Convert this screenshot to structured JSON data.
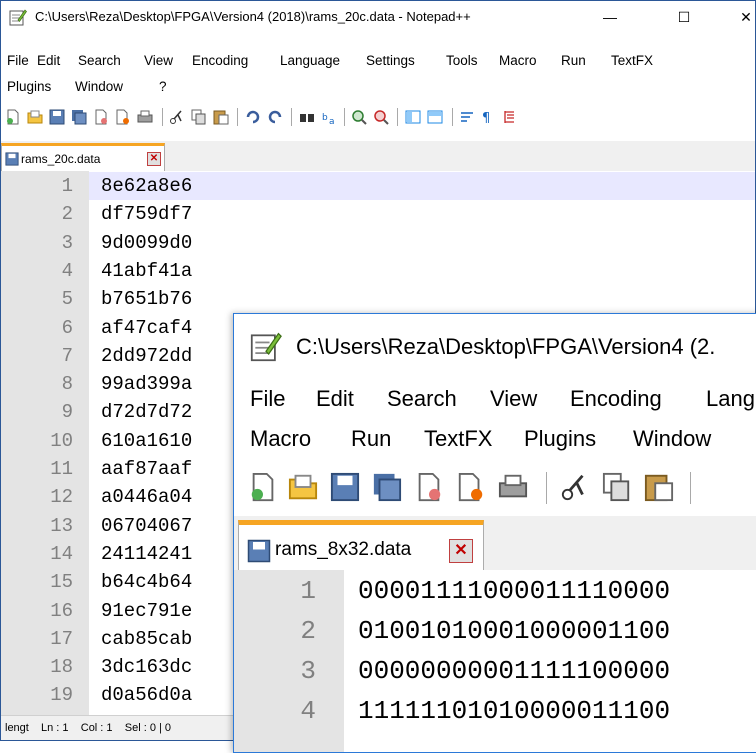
{
  "window1": {
    "title": "C:\\Users\\Reza\\Desktop\\FPGA\\Version4 (2018)\\rams_20c.data - Notepad++",
    "controls": {
      "minimize": "—",
      "maximize": "☐",
      "close": "✕"
    },
    "menu_row1": [
      "File",
      "Edit",
      "Search",
      "View",
      "Encoding",
      "Language",
      "Settings",
      "Tools",
      "Macro",
      "Run",
      "TextFX"
    ],
    "menu_row2": [
      "Plugins",
      "Window",
      "?"
    ],
    "tab": {
      "label": "rams_20c.data",
      "close": "✕"
    },
    "lines": [
      {
        "n": "1",
        "t": "8e62a8e6"
      },
      {
        "n": "2",
        "t": "df759df7"
      },
      {
        "n": "3",
        "t": "9d0099d0"
      },
      {
        "n": "4",
        "t": "41abf41a"
      },
      {
        "n": "5",
        "t": "b7651b76"
      },
      {
        "n": "6",
        "t": "af47caf4"
      },
      {
        "n": "7",
        "t": "2dd972dd"
      },
      {
        "n": "8",
        "t": "99ad399a"
      },
      {
        "n": "9",
        "t": "d72d7d72"
      },
      {
        "n": "10",
        "t": "610a1610"
      },
      {
        "n": "11",
        "t": "aaf87aaf"
      },
      {
        "n": "12",
        "t": "a0446a04"
      },
      {
        "n": "13",
        "t": "06704067"
      },
      {
        "n": "14",
        "t": "24114241"
      },
      {
        "n": "15",
        "t": "b64c4b64"
      },
      {
        "n": "16",
        "t": "91ec791e"
      },
      {
        "n": "17",
        "t": "cab85cab"
      },
      {
        "n": "18",
        "t": "3dc163dc"
      },
      {
        "n": "19",
        "t": "d0a56d0a"
      }
    ],
    "status": {
      "length": "lengt",
      "position": "Ln : 1    Col : 1    Sel : 0 | 0"
    }
  },
  "window2": {
    "title": "C:\\Users\\Reza\\Desktop\\FPGA\\Version4 (2.",
    "menu_row1": [
      "File",
      "Edit",
      "Search",
      "View",
      "Encoding",
      "Lang"
    ],
    "menu_row2": [
      "Macro",
      "Run",
      "TextFX",
      "Plugins",
      "Window"
    ],
    "tab": {
      "label": "rams_8x32.data",
      "close": "✕"
    },
    "lines": [
      {
        "n": "1",
        "t": "00001111000011110000"
      },
      {
        "n": "2",
        "t": "01001010001000001100"
      },
      {
        "n": "3",
        "t": "00000000001111100000"
      },
      {
        "n": "4",
        "t": "11111101010000011100"
      }
    ]
  },
  "colors": {
    "accent_tab": "#f6a523",
    "gutter": "#e4e4e4",
    "current_line": "#e8e8ff",
    "window_border": "#2b5797"
  },
  "icons": [
    "notepadpp-icon",
    "new-file-icon",
    "open-file-icon",
    "save-icon",
    "save-all-icon",
    "close-icon",
    "close-all-icon",
    "print-icon",
    "cut-icon",
    "copy-icon",
    "paste-icon",
    "undo-icon",
    "redo-icon",
    "find-icon",
    "replace-icon",
    "zoom-in-icon",
    "zoom-out-icon",
    "sync-v-icon",
    "sync-h-icon",
    "wrap-icon",
    "show-all-chars-icon",
    "indent-guide-icon"
  ]
}
